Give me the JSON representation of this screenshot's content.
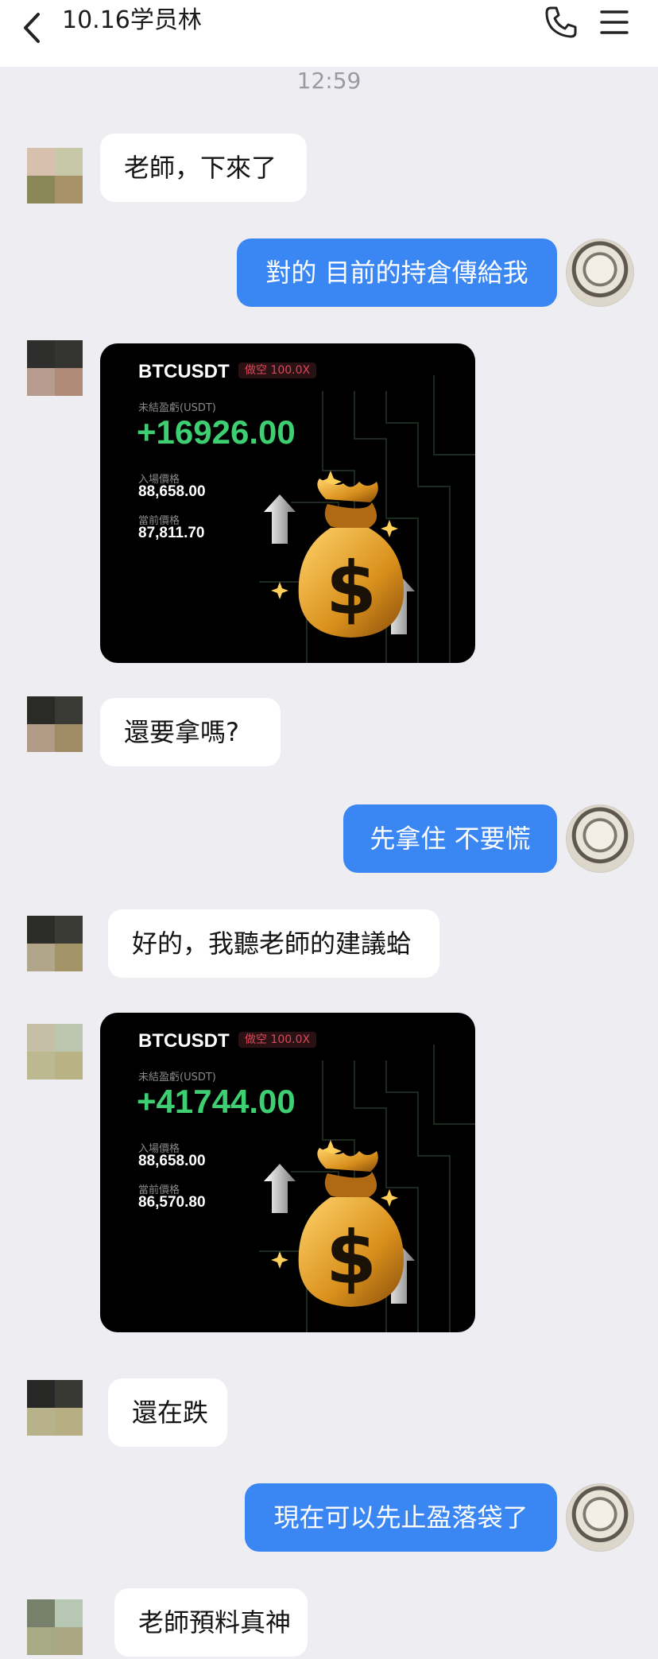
{
  "header": {
    "title": "10.16学员林"
  },
  "timestamp": "12:59",
  "messages": {
    "m1": "老師，下來了",
    "m2": "對的 目前的持倉傳給我",
    "m4": "還要拿嗎?",
    "m5": "先拿住 不要慌",
    "m6": "好的，我聽老師的建議蛤",
    "m8": "還在跌",
    "m9": "現在可以先止盈落袋了",
    "m10": "老師預料真神"
  },
  "cards": [
    {
      "symbol": "BTCUSDT",
      "tag": "做空 100.0X",
      "pnl_label": "未結盈虧(USDT)",
      "pnl": "+16926.00",
      "entry_label": "入場價格",
      "entry": "88,658.00",
      "current_label": "當前價格",
      "current": "87,811.70"
    },
    {
      "symbol": "BTCUSDT",
      "tag": "做空 100.0X",
      "pnl_label": "未結盈虧(USDT)",
      "pnl": "+41744.00",
      "entry_label": "入場價格",
      "entry": "88,658.00",
      "current_label": "當前價格",
      "current": "86,570.80"
    }
  ],
  "colors": {
    "accent": "#3a86f3",
    "profit": "#3fcf73",
    "short_tag": "#d8485b"
  },
  "icons": [
    "back-icon",
    "phone-icon",
    "menu-icon",
    "money-bag-icon",
    "arrow-up-icon",
    "sparkle-icon"
  ]
}
